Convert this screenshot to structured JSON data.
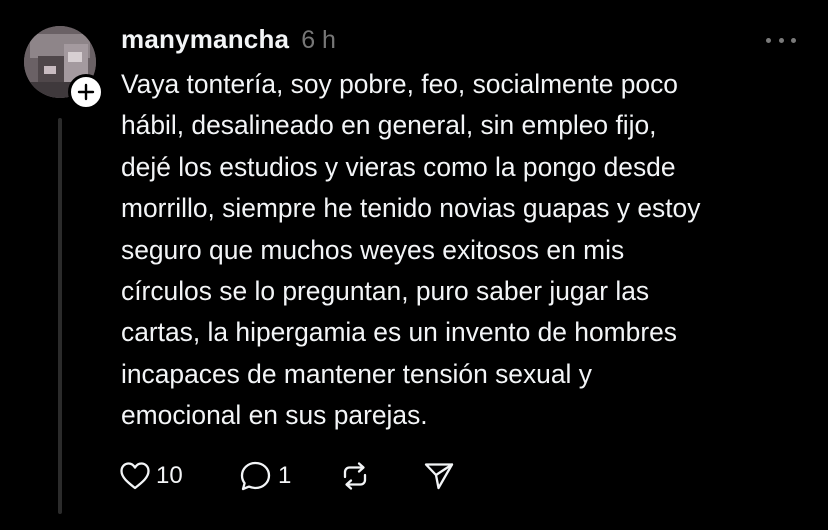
{
  "post": {
    "username": "manymancha",
    "time": "6 h",
    "text_lines": [
      "Vaya tontería, soy pobre, feo, socialmente poco",
      "hábil, desalineado en general, sin empleo fijo,",
      "dejé los estudios y vieras como la pongo desde",
      "morrillo, siempre he tenido novias guapas y estoy",
      "seguro que muchos weyes exitosos en mis",
      "círculos se lo preguntan, puro saber jugar las",
      "cartas, la hipergamia es un invento de hombres",
      "incapaces de mantener tensión sexual y",
      "emocional en sus parejas."
    ],
    "likes": "10",
    "replies": "1"
  },
  "icons": {
    "avatar": "avatar",
    "follow": "plus-icon",
    "more": "more-icon",
    "like": "heart-icon",
    "reply": "comment-icon",
    "repost": "repost-icon",
    "share": "send-icon"
  },
  "colors": {
    "background": "#000000",
    "text": "#f3f5f7",
    "muted": "#777777",
    "thread_line": "#2b2b2b"
  }
}
